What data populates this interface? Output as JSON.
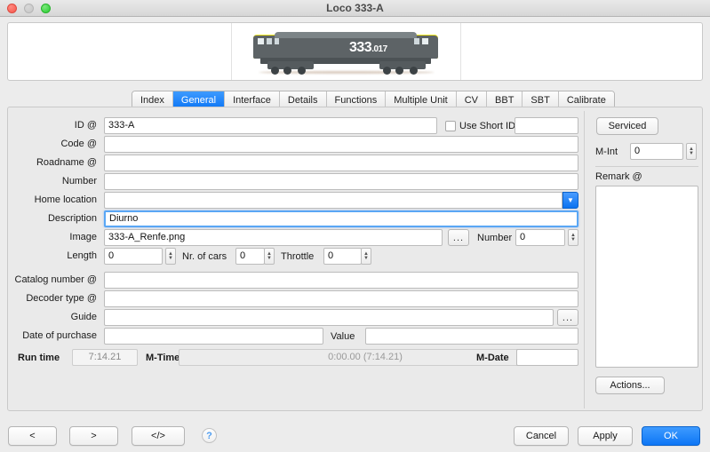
{
  "window": {
    "title": "Loco 333-A",
    "controls": {
      "close": "close",
      "minimize": "minimize",
      "zoom": "zoom"
    }
  },
  "image_panel": {
    "loco_number_main": "333",
    "loco_number_sub": ".017"
  },
  "tabs": [
    {
      "label": "Index",
      "active": false
    },
    {
      "label": "General",
      "active": true
    },
    {
      "label": "Interface",
      "active": false
    },
    {
      "label": "Details",
      "active": false
    },
    {
      "label": "Functions",
      "active": false
    },
    {
      "label": "Multiple Unit",
      "active": false
    },
    {
      "label": "CV",
      "active": false
    },
    {
      "label": "BBT",
      "active": false
    },
    {
      "label": "SBT",
      "active": false
    },
    {
      "label": "Calibrate",
      "active": false
    }
  ],
  "form": {
    "id": {
      "label": "ID @",
      "value": "333-A"
    },
    "use_short_id": {
      "label": "Use Short ID",
      "checked": false,
      "value": ""
    },
    "code": {
      "label": "Code @",
      "value": ""
    },
    "roadname": {
      "label": "Roadname @",
      "value": ""
    },
    "number": {
      "label": "Number",
      "value": ""
    },
    "home_location": {
      "label": "Home location",
      "value": ""
    },
    "description": {
      "label": "Description",
      "value": "Diurno"
    },
    "image": {
      "label": "Image",
      "value": "333-A_Renfe.png",
      "browse_label": "..."
    },
    "image_number": {
      "label": "Number",
      "value": "0"
    },
    "length": {
      "label": "Length",
      "value": "0"
    },
    "nr_of_cars": {
      "label": "Nr. of cars",
      "value": "0"
    },
    "throttle": {
      "label": "Throttle",
      "value": "0"
    },
    "catalog_number": {
      "label": "Catalog number @",
      "value": ""
    },
    "decoder_type": {
      "label": "Decoder type @",
      "value": ""
    },
    "guide": {
      "label": "Guide",
      "value": "",
      "browse_label": "..."
    },
    "date_of_purchase": {
      "label": "Date of purchase",
      "value": ""
    },
    "value_field": {
      "label": "Value",
      "value": ""
    },
    "run_time": {
      "label": "Run time",
      "value": "7:14.21"
    },
    "m_time": {
      "label": "M-Time",
      "value": "0:00.00 (7:14.21)"
    },
    "m_date": {
      "label": "M-Date",
      "value": ""
    }
  },
  "side_panel": {
    "serviced_label": "Serviced",
    "m_int": {
      "label": "M-Int",
      "value": "0"
    },
    "remark": {
      "label": "Remark @",
      "value": ""
    },
    "actions_label": "Actions..."
  },
  "footer": {
    "prev_label": "<",
    "next_label": ">",
    "code_label": "</>",
    "help_label": "?",
    "cancel_label": "Cancel",
    "apply_label": "Apply",
    "ok_label": "OK"
  },
  "colors": {
    "accent": "#0d76f5",
    "window_bg": "#ececec",
    "panel_bg": "#eaeaea",
    "field_bg": "#ffffff",
    "loco_yellow": "#f2e61b",
    "loco_grey": "#5d6366"
  }
}
